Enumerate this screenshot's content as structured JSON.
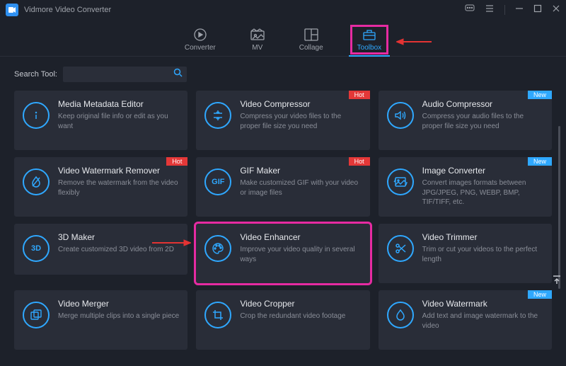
{
  "app": {
    "title": "Vidmore Video Converter"
  },
  "tabs": [
    {
      "label": "Converter"
    },
    {
      "label": "MV"
    },
    {
      "label": "Collage"
    },
    {
      "label": "Toolbox"
    }
  ],
  "search": {
    "label": "Search Tool:",
    "placeholder": ""
  },
  "tools": [
    {
      "title": "Media Metadata Editor",
      "desc": "Keep original file info or edit as you want",
      "badge": ""
    },
    {
      "title": "Video Compressor",
      "desc": "Compress your video files to the proper file size you need",
      "badge": "Hot"
    },
    {
      "title": "Audio Compressor",
      "desc": "Compress your audio files to the proper file size you need",
      "badge": "New"
    },
    {
      "title": "Video Watermark Remover",
      "desc": "Remove the watermark from the video flexibly",
      "badge": "Hot"
    },
    {
      "title": "GIF Maker",
      "desc": "Make customized GIF with your video or image files",
      "badge": "Hot"
    },
    {
      "title": "Image Converter",
      "desc": "Convert images formats between JPG/JPEG, PNG, WEBP, BMP, TIF/TIFF, etc.",
      "badge": "New"
    },
    {
      "title": "3D Maker",
      "desc": "Create customized 3D video from 2D",
      "badge": ""
    },
    {
      "title": "Video Enhancer",
      "desc": "Improve your video quality in several ways",
      "badge": ""
    },
    {
      "title": "Video Trimmer",
      "desc": "Trim or cut your videos to the perfect length",
      "badge": ""
    },
    {
      "title": "Video Merger",
      "desc": "Merge multiple clips into a single piece",
      "badge": ""
    },
    {
      "title": "Video Cropper",
      "desc": "Crop the redundant video footage",
      "badge": ""
    },
    {
      "title": "Video Watermark",
      "desc": "Add text and image watermark to the video",
      "badge": "New"
    }
  ],
  "badges": {
    "hot": "Hot",
    "new": "New"
  },
  "colors": {
    "accent": "#2fa8ff",
    "highlight": "#e62ba2",
    "hot": "#e43838"
  }
}
